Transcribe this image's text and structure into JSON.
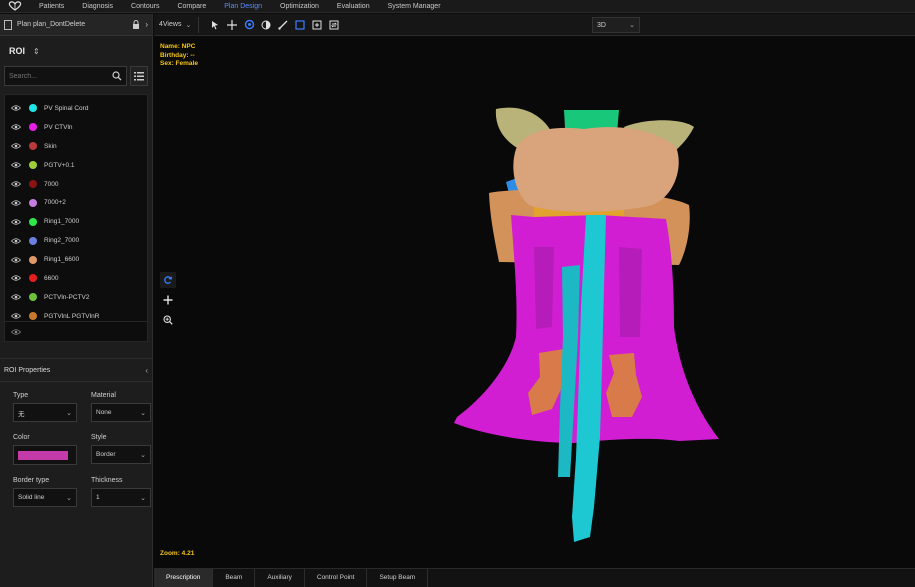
{
  "topnav": {
    "items": [
      {
        "label": "Patients",
        "active": false
      },
      {
        "label": "Diagnosis",
        "active": false
      },
      {
        "label": "Contours",
        "active": false
      },
      {
        "label": "Compare",
        "active": false
      },
      {
        "label": "Plan Design",
        "active": true
      },
      {
        "label": "Optimization",
        "active": false
      },
      {
        "label": "Evaluation",
        "active": false
      },
      {
        "label": "System Manager",
        "active": false
      }
    ]
  },
  "sidebar": {
    "plan_name": "Plan plan_DontDelete",
    "roi_header": "ROI",
    "search_placeholder": "Search...",
    "roi_items": [
      {
        "name": "PV Spinal Cord",
        "color": "#1ee6e6"
      },
      {
        "name": "PV CTVln",
        "color": "#e61ee6"
      },
      {
        "name": "Skin",
        "color": "#b83a3a"
      },
      {
        "name": "PGTV+0.1",
        "color": "#9ecf3a"
      },
      {
        "name": "7000",
        "color": "#8a1414"
      },
      {
        "name": "7000+2",
        "color": "#c77de0"
      },
      {
        "name": "Ring1_7000",
        "color": "#2ee84a"
      },
      {
        "name": "Ring2_7000",
        "color": "#6a7fe0"
      },
      {
        "name": "Ring1_6600",
        "color": "#e09a6a"
      },
      {
        "name": "6600",
        "color": "#e61e1e"
      },
      {
        "name": "PCTVln-PCTV2",
        "color": "#6cc23a"
      },
      {
        "name": "PGTVlnL PGTVlnR",
        "color": "#c8782e"
      }
    ],
    "properties": {
      "header": "ROI Properties",
      "type_label": "Type",
      "type_value": "无",
      "material_label": "Material",
      "material_value": "None",
      "color_label": "Color",
      "color_value": "#c43aa8",
      "style_label": "Style",
      "style_value": "Border",
      "border_type_label": "Border type",
      "border_type_value": "Solid line",
      "thickness_label": "Thickness",
      "thickness_value": "1"
    }
  },
  "toolbar": {
    "views_label": "4Views",
    "mode_label": "3D"
  },
  "viewport": {
    "name_line": "Name: NPC",
    "birthday_line": "Birthday: --",
    "sex_line": "Sex: Female",
    "zoom_line": "Zoom: 4.21"
  },
  "bottom_tabs": [
    {
      "label": "Prescription",
      "active": true
    },
    {
      "label": "Beam",
      "active": false
    },
    {
      "label": "Auxiliary",
      "active": false
    },
    {
      "label": "Control Point",
      "active": false
    },
    {
      "label": "Setup Beam",
      "active": false
    }
  ]
}
